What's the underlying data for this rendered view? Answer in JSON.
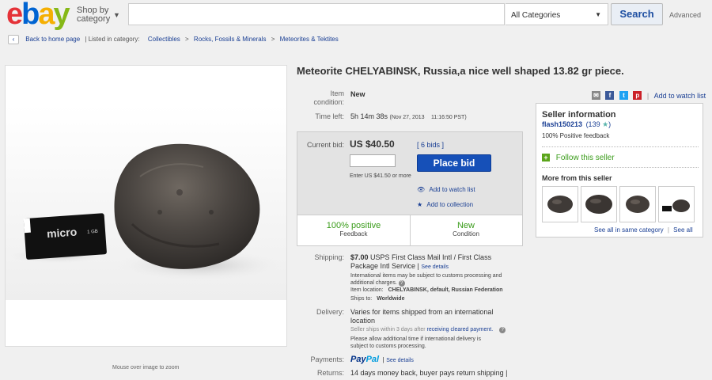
{
  "header": {
    "logo_letters": [
      "e",
      "b",
      "a",
      "y"
    ],
    "shop_by": "Shop by",
    "category": "category",
    "search_value": "",
    "category_select": "All Categories",
    "search_button": "Search",
    "advanced": "Advanced"
  },
  "breadcrumb": {
    "back": "Back to home page",
    "listed_in": "| Listed in category:",
    "items": [
      "Collectibles",
      "Rocks, Fossils & Minerals",
      "Meteorites & Tektites"
    ]
  },
  "image": {
    "hint": "Mouse over image to zoom",
    "card_text": "micro",
    "card_text2": "1 GB"
  },
  "listing": {
    "title": "Meteorite CHELYABINSK, Russia,a nice well shaped 13.82 gr piece.",
    "item_condition_label_1": "Item",
    "item_condition_label_2": "condition:",
    "item_condition": "New",
    "time_left_label": "Time left:",
    "time_left": "5h 14m 38s",
    "time_left_date": "(Nov 27, 2013",
    "time_left_time": "11:16:50 PST)"
  },
  "bid": {
    "current_bid_label": "Current bid:",
    "current_bid": "US $40.50",
    "bids": "[ 6 bids ]",
    "input_value": "",
    "place_bid": "Place bid",
    "enter_hint": "Enter US $41.50 or more",
    "add_watch": "Add to watch list",
    "add_collection": "Add to collection",
    "positive": "100% positive",
    "feedback": "Feedback",
    "new": "New",
    "condition": "Condition"
  },
  "shipping": {
    "label": "Shipping:",
    "price": "$7.00",
    "service_1": "USPS First Class Mail Intl / First Class",
    "service_2": "Package Intl Service",
    "see_details": "See details",
    "intl_note_1": "International items may be subject to customs processing and",
    "intl_note_2": "additional charges.",
    "location_label": "Item location:",
    "location": "CHELYABINSK, default, Russian Federation",
    "ships_label": "Ships to:",
    "ships": "Worldwide"
  },
  "delivery": {
    "label": "Delivery:",
    "text_1": "Varies for items shipped from an international",
    "text_2": "location",
    "ships_within": "Seller ships within 3 days after",
    "cleared": "receiving cleared payment.",
    "note_1": "Please allow additional time if international delivery is",
    "note_2": "subject to customs processing."
  },
  "payments": {
    "label": "Payments:",
    "paypal_1": "Pay",
    "paypal_2": "Pal",
    "see_details": "See details"
  },
  "returns": {
    "label": "Returns:",
    "text": "14 days money back, buyer pays return shipping"
  },
  "seller": {
    "watch_link": "Add to watch list",
    "title": "Seller information",
    "name": "flash150213",
    "score": "(139",
    "feedback": "100% Positive feedback",
    "follow": "Follow this seller",
    "more": "More from this seller",
    "see_category": "See all in same category",
    "see_all": "See all"
  },
  "colors": {
    "link": "#1a3f94",
    "place_bid": "#1650b8",
    "positive": "#3a9c1a"
  }
}
